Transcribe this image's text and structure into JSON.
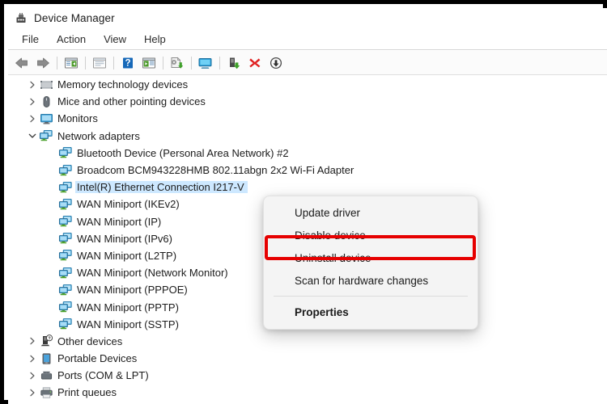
{
  "window": {
    "title": "Device Manager",
    "icon": "device-manager-icon"
  },
  "menu_bar": {
    "items": [
      {
        "label": "File",
        "name": "menubar-file"
      },
      {
        "label": "Action",
        "name": "menubar-action"
      },
      {
        "label": "View",
        "name": "menubar-view"
      },
      {
        "label": "Help",
        "name": "menubar-help"
      }
    ]
  },
  "toolbar": {
    "buttons": [
      {
        "icon": "back-arrow-icon",
        "label": "Back"
      },
      {
        "icon": "forward-arrow-icon",
        "label": "Forward"
      },
      {
        "icon": "show-hide-console-tree-icon",
        "label": "Show/Hide Console Tree"
      },
      {
        "icon": "properties-window-icon",
        "label": "Properties"
      },
      {
        "icon": "help-question-icon",
        "label": "Help"
      },
      {
        "icon": "show-hide-action-pane-icon",
        "label": "Show/Hide Action Pane"
      },
      {
        "icon": "update-driver-icon",
        "label": "Update Driver Software"
      },
      {
        "icon": "scan-hardware-changes-icon",
        "label": "Scan for hardware changes"
      },
      {
        "icon": "enable-device-icon",
        "label": "Enable device"
      },
      {
        "icon": "uninstall-device-red-x-icon",
        "label": "Uninstall device"
      },
      {
        "icon": "disable-device-down-arrow-icon",
        "label": "Disable device"
      }
    ]
  },
  "tree": {
    "nodes": [
      {
        "label": "Memory technology devices",
        "indent": 0,
        "chevron": "collapsed",
        "icon": "memory-device-icon",
        "selected": false
      },
      {
        "label": "Mice and other pointing devices",
        "indent": 0,
        "chevron": "collapsed",
        "icon": "mouse-icon",
        "selected": false
      },
      {
        "label": "Monitors",
        "indent": 0,
        "chevron": "collapsed",
        "icon": "monitor-icon",
        "selected": false
      },
      {
        "label": "Network adapters",
        "indent": 0,
        "chevron": "expanded",
        "icon": "network-adapter-icon",
        "selected": false
      },
      {
        "label": "Bluetooth Device (Personal Area Network) #2",
        "indent": 1,
        "chevron": "none",
        "icon": "network-adapter-icon",
        "selected": false
      },
      {
        "label": "Broadcom BCM943228HMB 802.11abgn 2x2 Wi-Fi Adapter",
        "indent": 1,
        "chevron": "none",
        "icon": "network-adapter-icon",
        "selected": false
      },
      {
        "label": "Intel(R) Ethernet Connection I217-V",
        "indent": 1,
        "chevron": "none",
        "icon": "network-adapter-icon",
        "selected": true
      },
      {
        "label": "WAN Miniport (IKEv2)",
        "indent": 1,
        "chevron": "none",
        "icon": "network-adapter-icon",
        "selected": false
      },
      {
        "label": "WAN Miniport (IP)",
        "indent": 1,
        "chevron": "none",
        "icon": "network-adapter-icon",
        "selected": false
      },
      {
        "label": "WAN Miniport (IPv6)",
        "indent": 1,
        "chevron": "none",
        "icon": "network-adapter-icon",
        "selected": false
      },
      {
        "label": "WAN Miniport (L2TP)",
        "indent": 1,
        "chevron": "none",
        "icon": "network-adapter-icon",
        "selected": false
      },
      {
        "label": "WAN Miniport (Network Monitor)",
        "indent": 1,
        "chevron": "none",
        "icon": "network-adapter-icon",
        "selected": false
      },
      {
        "label": "WAN Miniport (PPPOE)",
        "indent": 1,
        "chevron": "none",
        "icon": "network-adapter-icon",
        "selected": false
      },
      {
        "label": "WAN Miniport (PPTP)",
        "indent": 1,
        "chevron": "none",
        "icon": "network-adapter-icon",
        "selected": false
      },
      {
        "label": "WAN Miniport (SSTP)",
        "indent": 1,
        "chevron": "none",
        "icon": "network-adapter-icon",
        "selected": false
      },
      {
        "label": "Other devices",
        "indent": 0,
        "chevron": "collapsed",
        "icon": "unknown-device-icon",
        "selected": false
      },
      {
        "label": "Portable Devices",
        "indent": 0,
        "chevron": "collapsed",
        "icon": "portable-device-icon",
        "selected": false
      },
      {
        "label": "Ports (COM & LPT)",
        "indent": 0,
        "chevron": "collapsed",
        "icon": "port-icon",
        "selected": false
      },
      {
        "label": "Print queues",
        "indent": 0,
        "chevron": "collapsed",
        "icon": "printer-icon",
        "selected": false
      }
    ]
  },
  "context_menu": {
    "items": [
      {
        "label": "Update driver",
        "bold": false,
        "separator_after": false,
        "name": "ctx-update-driver"
      },
      {
        "label": "Disable device",
        "bold": false,
        "separator_after": false,
        "name": "ctx-disable-device"
      },
      {
        "label": "Uninstall device",
        "bold": false,
        "separator_after": false,
        "name": "ctx-uninstall-device"
      },
      {
        "label": "Scan for hardware changes",
        "bold": false,
        "separator_after": true,
        "name": "ctx-scan-hardware-changes"
      },
      {
        "label": "Properties",
        "bold": true,
        "separator_after": false,
        "name": "ctx-properties"
      }
    ]
  },
  "annotation": {
    "highlight_color": "#e60000",
    "highlight_target": "Uninstall device"
  },
  "colors": {
    "selection_blue": "#cde8ff",
    "window_border": "#000000",
    "menu_background": "#f4f4f4",
    "toolbar_red_x": "#e02020"
  }
}
